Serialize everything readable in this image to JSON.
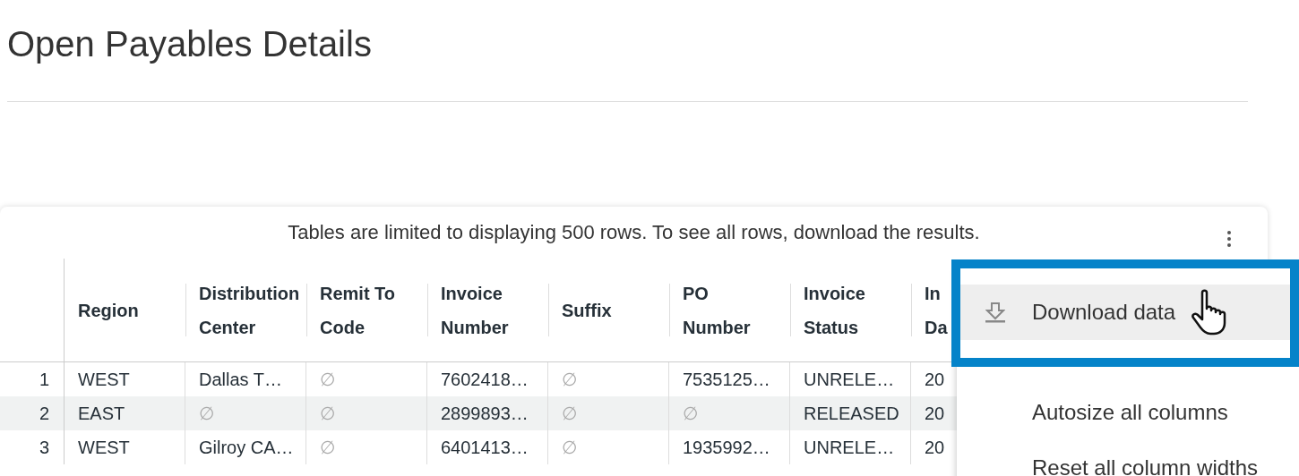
{
  "page": {
    "title": "Open Payables Details"
  },
  "table": {
    "notice": "Tables are limited to displaying 500 rows. To see all rows, download the results.",
    "columns": [
      {},
      {
        "lines": [
          "Region"
        ]
      },
      {
        "lines": [
          "Distribution",
          "Center"
        ]
      },
      {
        "lines": [
          "Remit To",
          "Code"
        ]
      },
      {
        "lines": [
          "Invoice",
          "Number"
        ]
      },
      {
        "lines": [
          "Suffix"
        ]
      },
      {
        "lines": [
          "PO",
          "Number"
        ]
      },
      {
        "lines": [
          "Invoice",
          "Status"
        ]
      },
      {
        "lines": [
          "In",
          "Da"
        ]
      }
    ],
    "rows": [
      {
        "cells": [
          "1",
          "WEST",
          "Dallas T…",
          "∅",
          "7602418…",
          "∅",
          "7535125…",
          "UNRELE…",
          "20"
        ]
      },
      {
        "cells": [
          "2",
          "EAST",
          "∅",
          "∅",
          "2899893…",
          "∅",
          "∅",
          "RELEASED",
          "20"
        ]
      },
      {
        "cells": [
          "3",
          "WEST",
          "Gilroy CA…",
          "∅",
          "6401413…",
          "∅",
          "1935992…",
          "UNRELE…",
          "20"
        ]
      }
    ]
  },
  "menu": {
    "items": [
      {
        "label": "Download data",
        "selected": true,
        "kind": "download"
      },
      {
        "label": "Autosize all columns",
        "selected": false,
        "kind": "plain"
      },
      {
        "label": "Reset all column widths",
        "selected": false,
        "kind": "plain"
      }
    ]
  }
}
